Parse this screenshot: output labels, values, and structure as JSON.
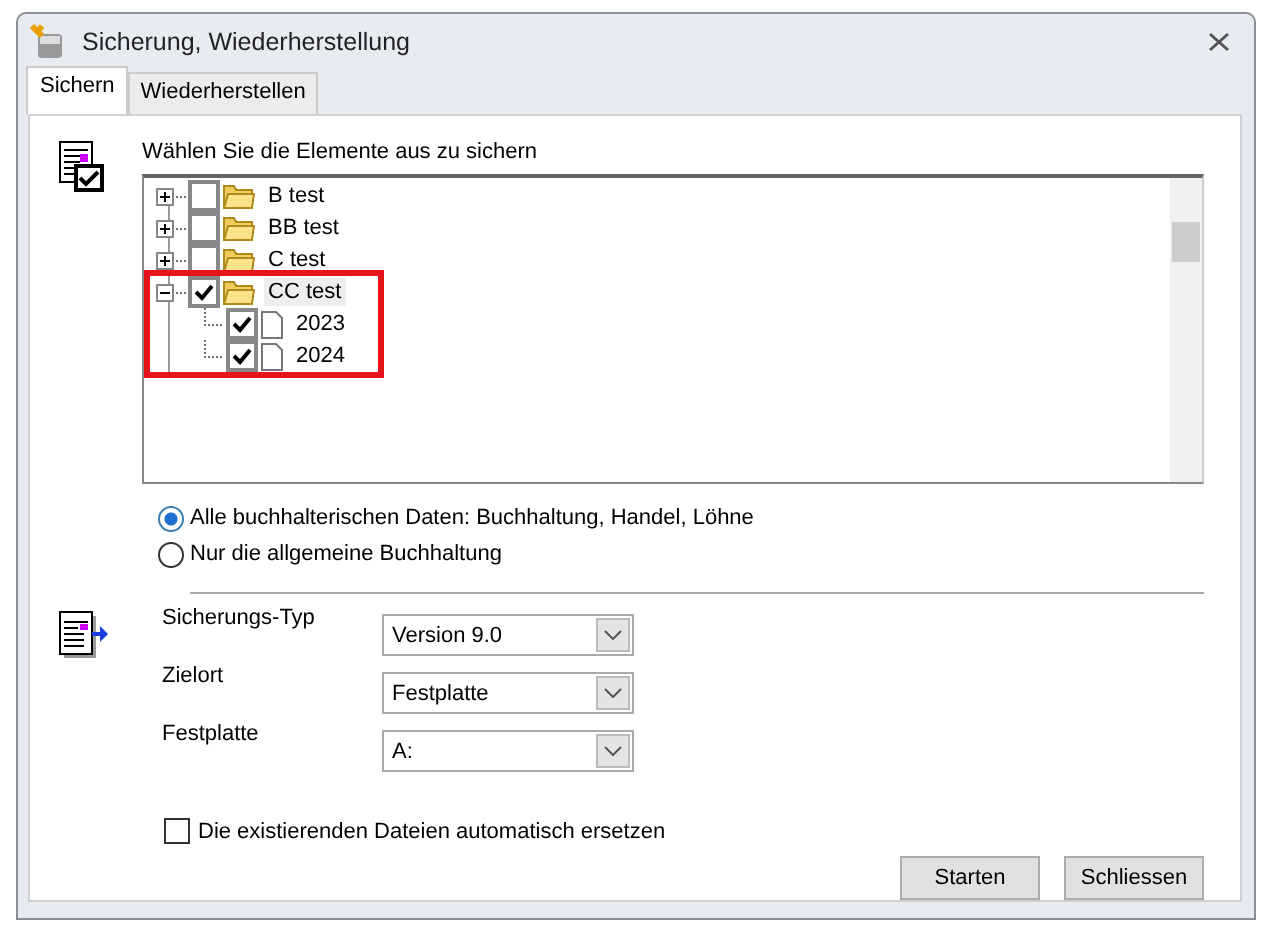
{
  "window": {
    "title": "Sicherung, Wiederherstellung"
  },
  "tabs": [
    {
      "label": "Sichern",
      "selected": true
    },
    {
      "label": "Wiederherstellen",
      "selected": false
    }
  ],
  "tree": {
    "heading": "Wählen Sie die Elemente aus zu sichern",
    "items": [
      {
        "label": "B test",
        "kind": "folder",
        "checked": false,
        "expanded": false,
        "selected": false,
        "highlighted": false
      },
      {
        "label": "BB test",
        "kind": "folder",
        "checked": false,
        "expanded": false,
        "selected": false,
        "highlighted": false
      },
      {
        "label": "C test",
        "kind": "folder",
        "checked": false,
        "expanded": false,
        "selected": false,
        "highlighted": false
      },
      {
        "label": "CC test",
        "kind": "folder",
        "checked": true,
        "expanded": true,
        "selected": true,
        "highlighted": true,
        "children": [
          {
            "label": "2023",
            "kind": "file",
            "checked": true
          },
          {
            "label": "2024",
            "kind": "file",
            "checked": true
          }
        ]
      }
    ]
  },
  "scope": [
    {
      "label": "Alle buchhalterischen Daten: Buchhaltung, Handel, Löhne",
      "selected": true
    },
    {
      "label": "Nur die allgemeine Buchhaltung",
      "selected": false
    }
  ],
  "settings": [
    {
      "label": "Sicherungs-Typ",
      "value": "Version 9.0"
    },
    {
      "label": "Zielort",
      "value": "Festplatte"
    },
    {
      "label": "Festplatte",
      "value": "A:"
    }
  ],
  "replace": {
    "label": "Die existierenden Dateien automatisch ersetzen",
    "checked": false
  },
  "buttons": [
    "Starten",
    "Schliessen"
  ]
}
